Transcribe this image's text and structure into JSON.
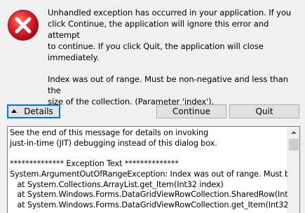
{
  "dialog": {
    "icon": "error-icon",
    "message_line_1": "Unhandled exception has occurred in your application. If you\nclick Continue, the application will ignore this error and attempt\nto continue. If you click Quit, the application will close\nimmediately.",
    "message_line_2": "Index was out of range. Must be non-negative and less than the\nsize of the collection. (Parameter 'index')."
  },
  "buttons": {
    "details_label": "Details",
    "continue_label": "Continue",
    "quit_label": "Quit"
  },
  "details": {
    "text": "See the end of this message for details on invoking\njust-in-time (JIT) debugging instead of this dialog box.\n\n************** Exception Text **************\nSystem.ArgumentOutOfRangeException: Index was out of range. Must be\n   at System.Collections.ArrayList.get_Item(Int32 index)\n   at System.Windows.Forms.DataGridViewRowCollection.SharedRow(Int32\n   at System.Windows.Forms.DataGridViewRowCollection.get_Item(Int32 in"
  },
  "colors": {
    "error_red": "#e81123",
    "focus_blue": "#0078d7"
  }
}
